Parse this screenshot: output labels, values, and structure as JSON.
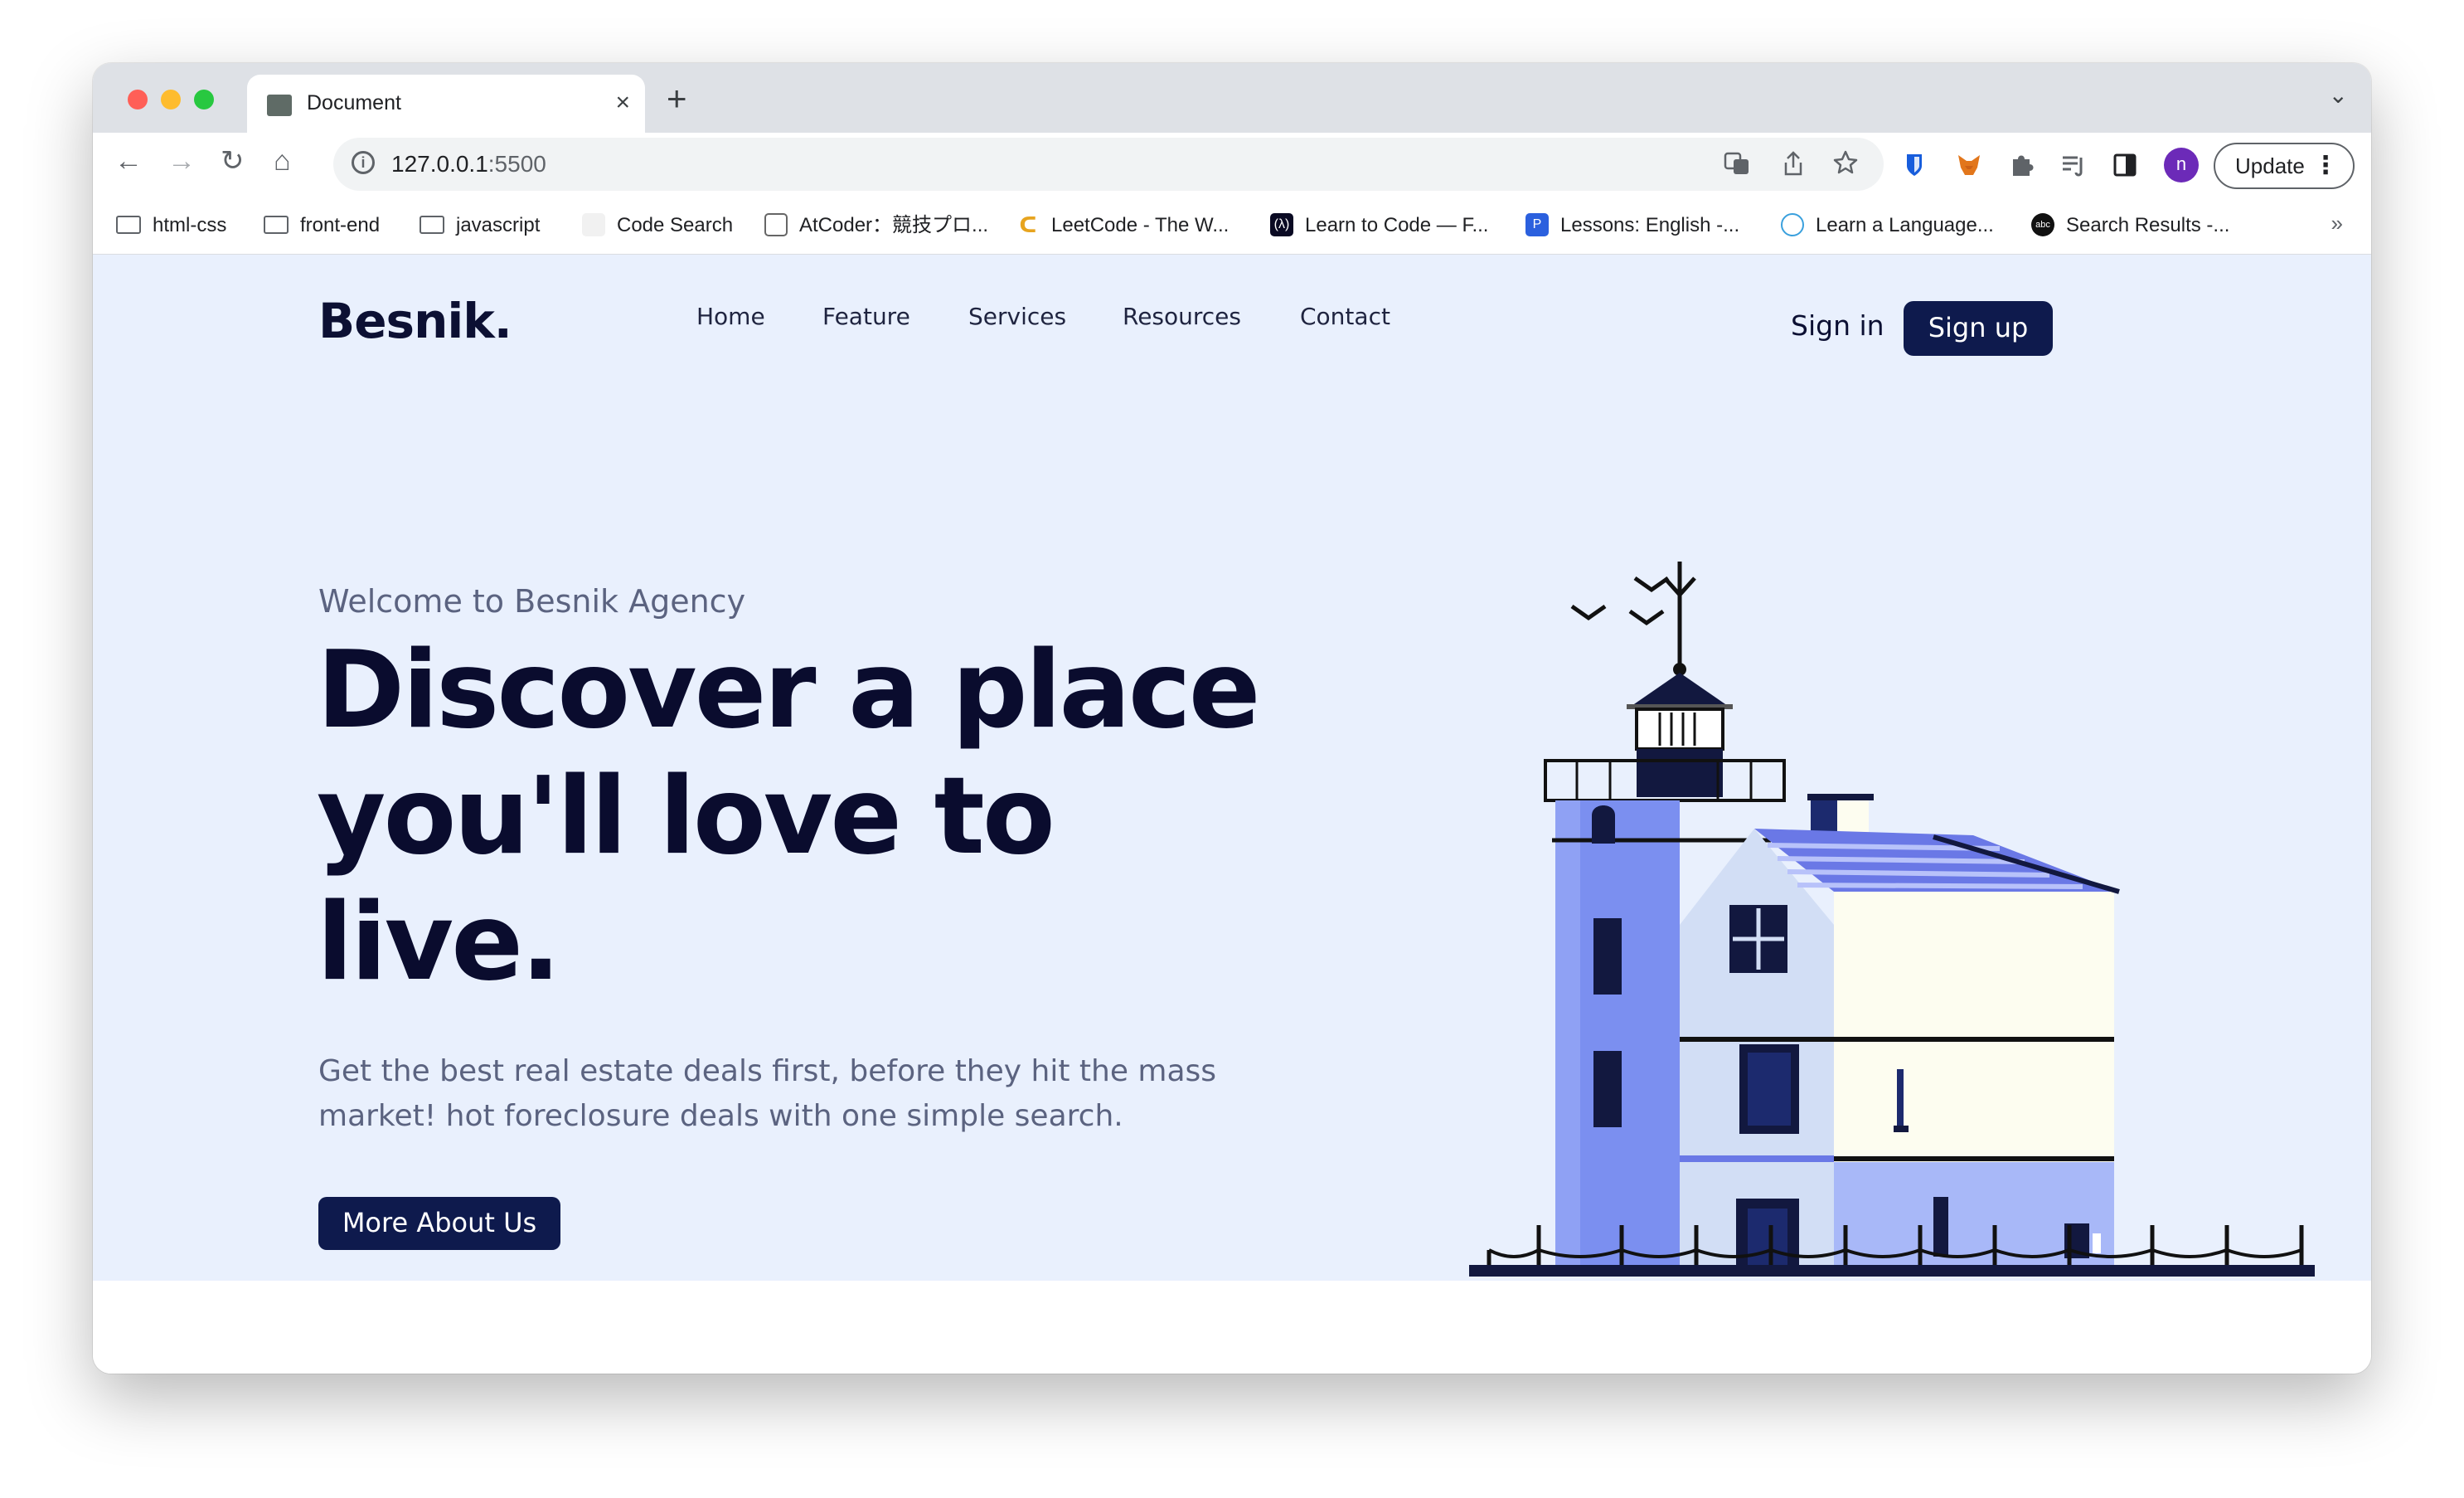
{
  "browser": {
    "tab_title": "Document",
    "tab_close": "×",
    "new_tab": "+",
    "tab_search": "⌄",
    "back": "←",
    "forward": "→",
    "reload": "↻",
    "home": "⌂",
    "url_host": "127.0.0.1",
    "url_port": ":5500",
    "info": "i",
    "profile_initial": "n",
    "update_label": "Update",
    "more": "⋮",
    "bookmarks_overflow": "»"
  },
  "bookmarks": [
    {
      "label": "html-css",
      "type": "folder"
    },
    {
      "label": "front-end",
      "type": "folder"
    },
    {
      "label": "javascript",
      "type": "folder"
    },
    {
      "label": "Code Search",
      "type": "site"
    },
    {
      "label": "AtCoder：競技プロ...",
      "type": "site"
    },
    {
      "label": "LeetCode - The W...",
      "type": "site"
    },
    {
      "label": "Learn to Code — F...",
      "type": "site"
    },
    {
      "label": "Lessons: English -...",
      "type": "site"
    },
    {
      "label": "Learn a Language...",
      "type": "site"
    },
    {
      "label": "Search Results -...",
      "type": "site"
    }
  ],
  "site": {
    "logo": "Besnik.",
    "nav": [
      "Home",
      "Feature",
      "Services",
      "Resources",
      "Contact"
    ],
    "sign_in": "Sign in",
    "sign_up": "Sign up"
  },
  "hero": {
    "welcome": "Welcome to Besnik Agency",
    "title": "Discover a place you'll love to live.",
    "description": "Get the best real estate deals first, before they hit the mass market! hot foreclosure deals with one simple search.",
    "cta": "More About Us"
  },
  "colors": {
    "page_bg": "#e9f0fd",
    "primary": "#0e1a4d",
    "heading": "#0a0c2e",
    "muted": "#5b6380",
    "tower_blue": "#7b8ff0",
    "roof_blue": "#6a78e6",
    "cream": "#fdfdf0"
  }
}
